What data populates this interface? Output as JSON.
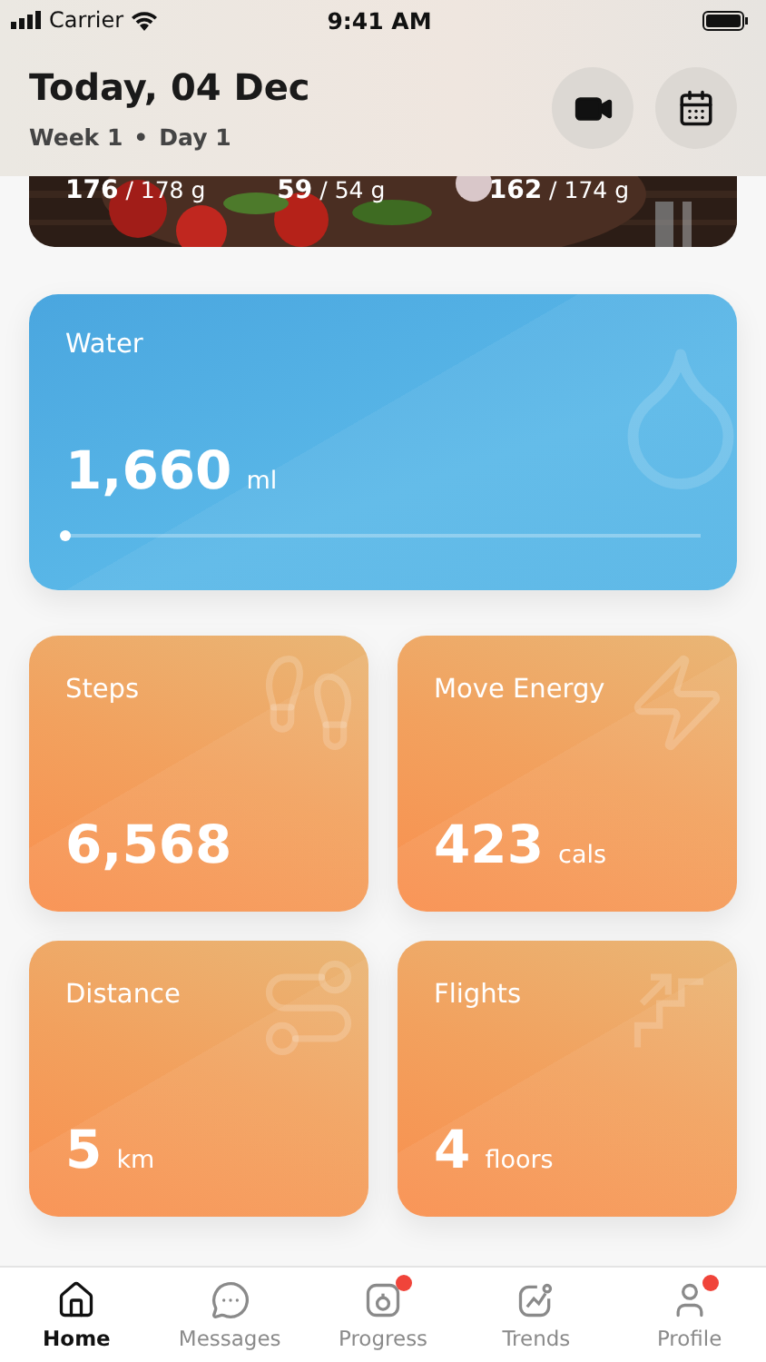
{
  "status_bar": {
    "carrier": "Carrier",
    "time": "9:41 AM"
  },
  "header": {
    "title": "Today, 04 Dec",
    "week": "Week 1",
    "day": "Day 1",
    "separator": "•"
  },
  "macros": [
    {
      "text": "**176** / 178 g"
    },
    {
      "text": "**59** / 54 g"
    },
    {
      "text": "**162** / 174 g"
    }
  ],
  "water": {
    "label": "Water",
    "value": "1,660",
    "unit": "ml",
    "level": 0
  },
  "tiles": [
    {
      "kind": "steps",
      "label": "Steps",
      "value": "6,568"
    },
    {
      "kind": "energy",
      "label": "Move Energy",
      "value": "423",
      "unit": "cals"
    },
    {
      "kind": "distance",
      "label": "Distance",
      "value": "5",
      "unit": "km"
    },
    {
      "kind": "flights",
      "label": "Flights",
      "value": "4",
      "unit": "floors"
    }
  ],
  "tab_bar": [
    {
      "kind": "home",
      "label": "Home",
      "selected": true,
      "badge": false
    },
    {
      "kind": "messages",
      "label": "Messages",
      "selected": false,
      "badge": false
    },
    {
      "kind": "progress",
      "label": "Progress",
      "selected": false,
      "badge": true
    },
    {
      "kind": "trends",
      "label": "Trends",
      "selected": false,
      "badge": false
    },
    {
      "kind": "profile",
      "label": "Profile",
      "selected": false,
      "badge": true
    }
  ]
}
